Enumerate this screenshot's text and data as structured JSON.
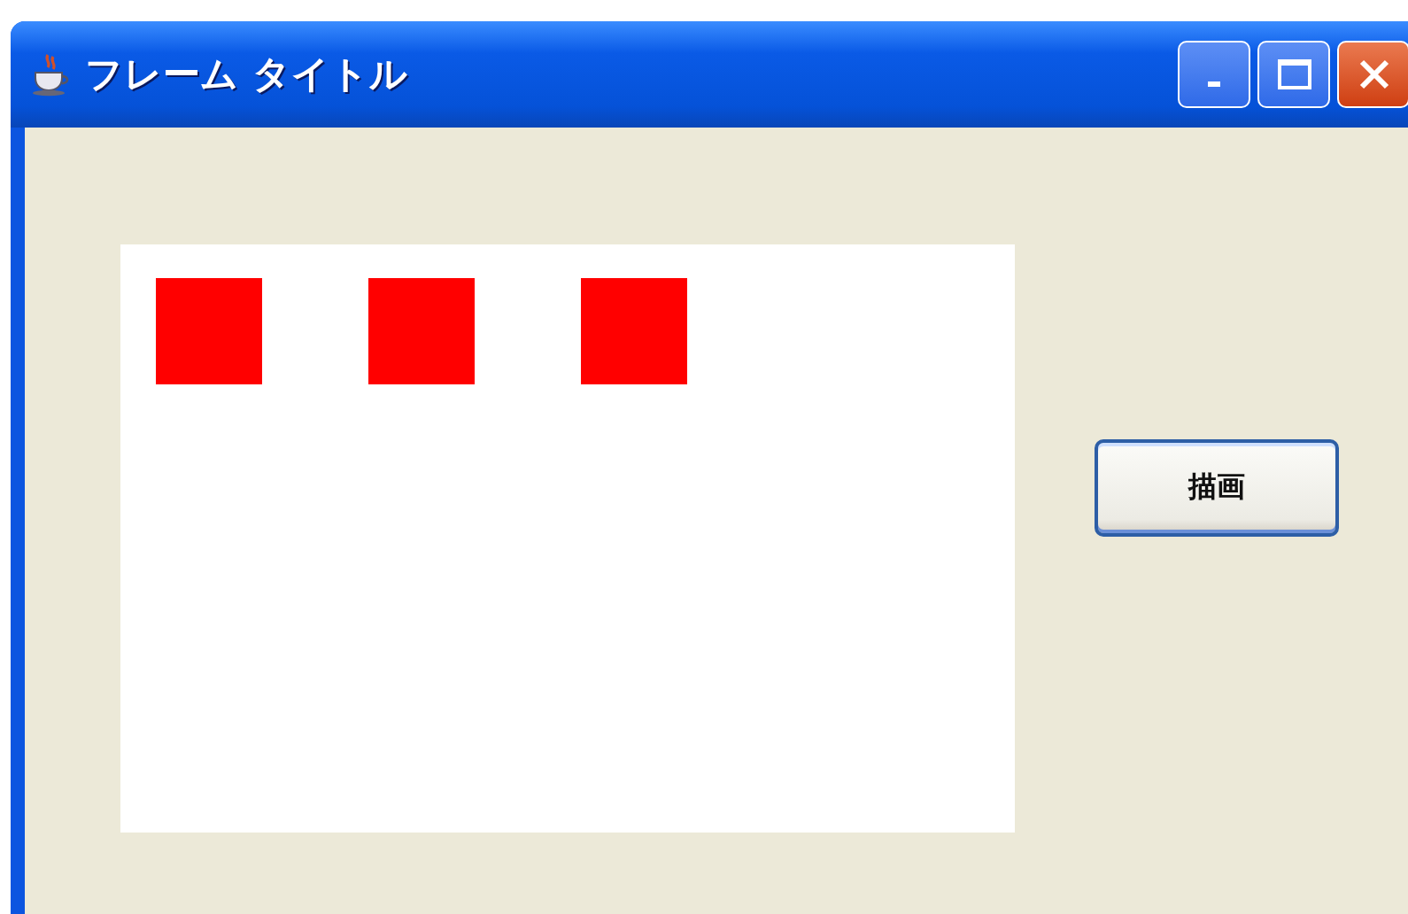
{
  "window": {
    "title": "フレーム タイトル"
  },
  "button": {
    "label": "描画"
  }
}
